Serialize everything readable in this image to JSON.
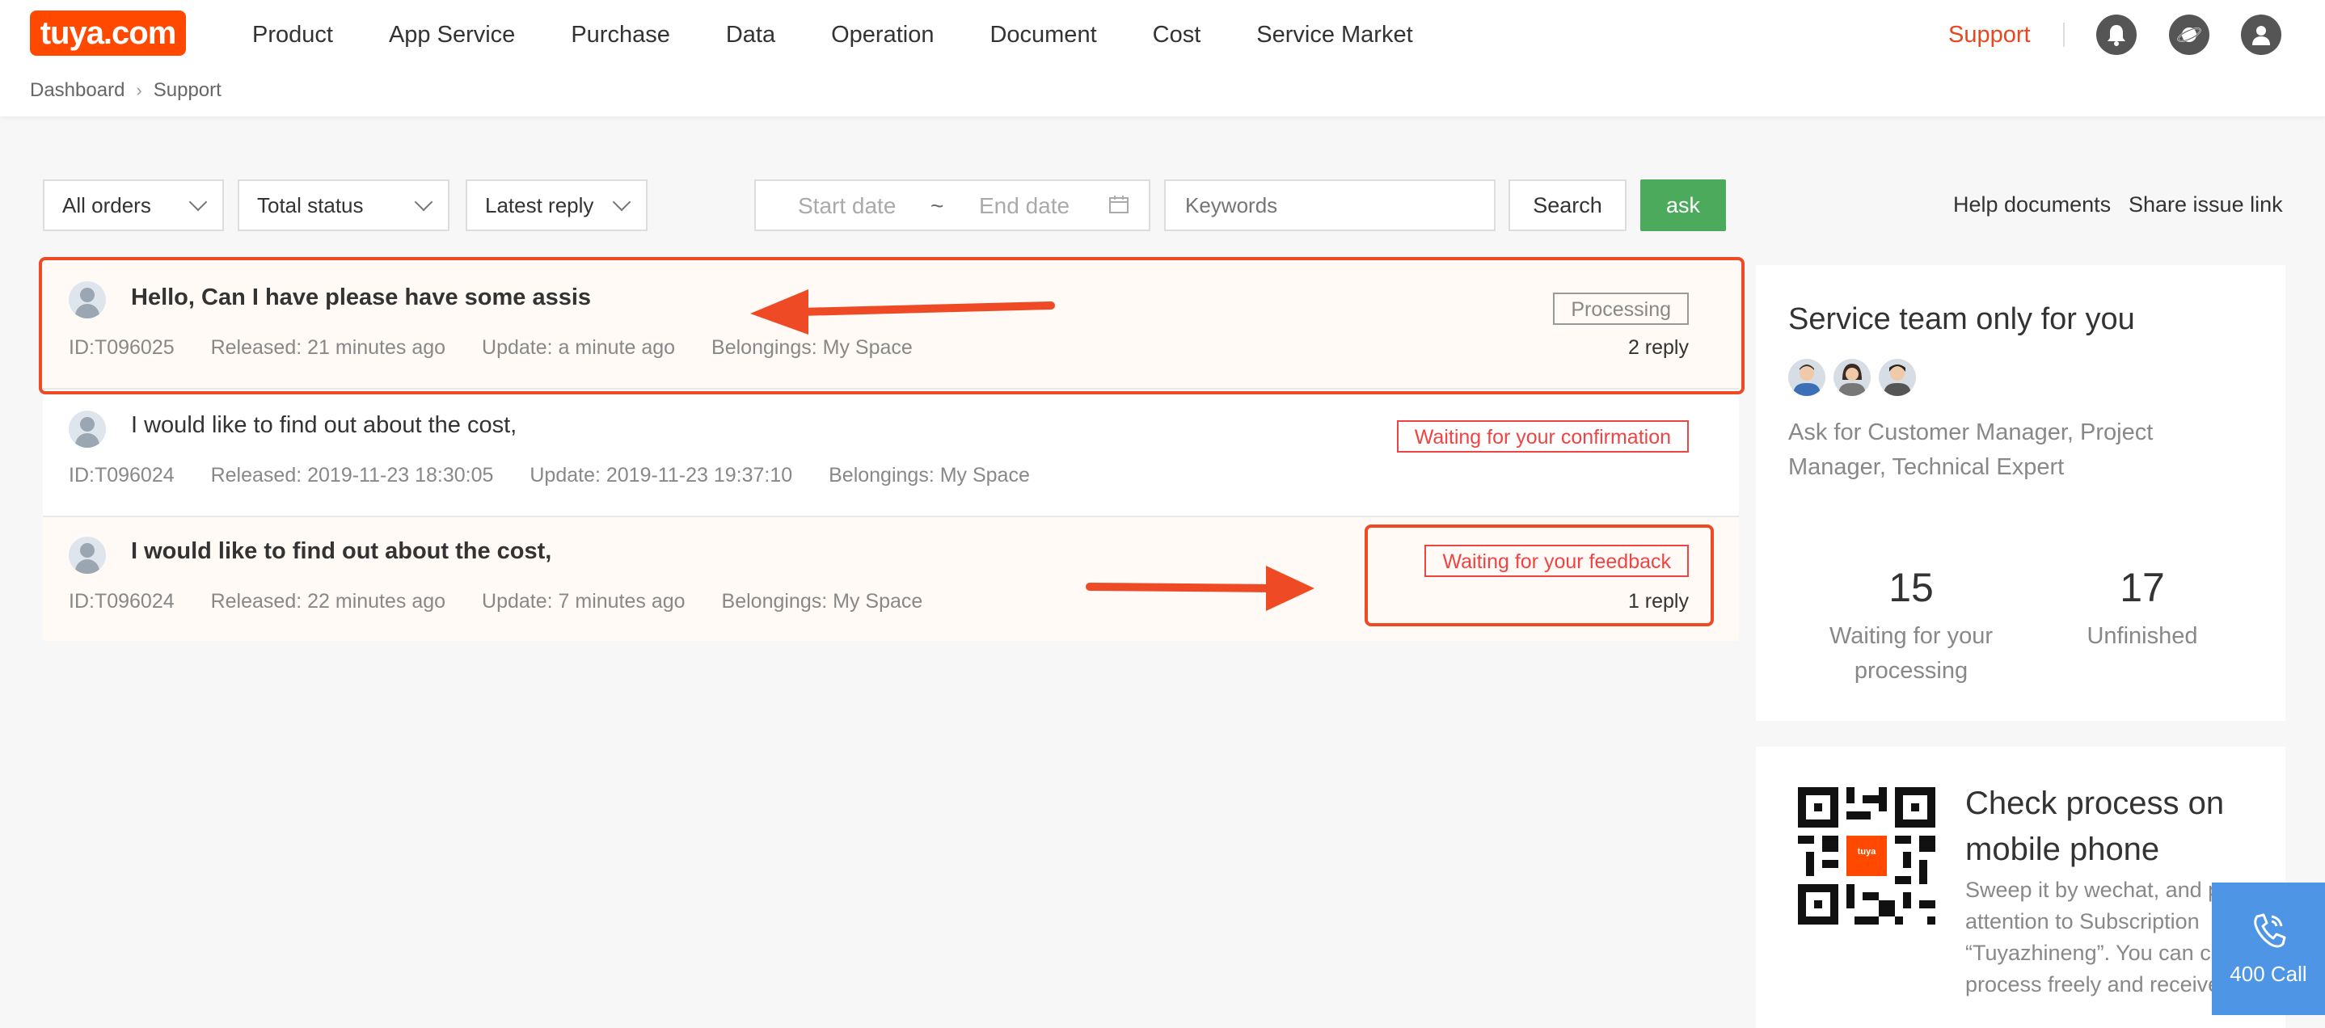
{
  "header": {
    "logo_text": "tuya.com",
    "nav": [
      "Product",
      "App Service",
      "Purchase",
      "Data",
      "Operation",
      "Document",
      "Cost",
      "Service Market"
    ],
    "support": "Support",
    "icons": [
      "bell-icon",
      "planet-icon",
      "user-icon"
    ]
  },
  "breadcrumb": [
    "Dashboard",
    "Support"
  ],
  "filters": {
    "orders": "All orders",
    "status": "Total status",
    "sort": "Latest reply",
    "start_date_placeholder": "Start date",
    "date_sep": "~",
    "end_date_placeholder": "End date",
    "keywords_placeholder": "Keywords",
    "search": "Search",
    "ask": "ask",
    "help_documents": "Help documents",
    "share_issue_link": "Share issue link"
  },
  "tickets": [
    {
      "title": "Hello, Can I have please have some assis",
      "id": "ID:T096025",
      "released": "Released: 21 minutes ago",
      "update": "Update: a minute ago",
      "belongings": "Belongings: My Space",
      "status": "Processing",
      "replies": "2 reply"
    },
    {
      "title": "I would like to find out about the cost,",
      "id": "ID:T096024",
      "released": "Released: 2019-11-23 18:30:05",
      "update": "Update: 2019-11-23 19:37:10",
      "belongings": "Belongings: My Space",
      "status": "Waiting for your confirmation",
      "replies": ""
    },
    {
      "title": "I would like to find out about the cost,",
      "id": "ID:T096024",
      "released": "Released: 22 minutes ago",
      "update": "Update: 7 minutes ago",
      "belongings": "Belongings: My Space",
      "status": "Waiting for your feedback",
      "replies": "1 reply"
    }
  ],
  "service_team": {
    "title": "Service team only for you",
    "description": "Ask for Customer Manager, Project Manager, Technical Expert",
    "stats": [
      {
        "value": "15",
        "label": "Waiting for your processing"
      },
      {
        "value": "17",
        "label": "Unfinished"
      }
    ]
  },
  "mobile": {
    "title": "Check process on mobile phone",
    "description": "Sweep it by wechat, and pay attention to Subscription “Tuyazhineng”. You can check process freely and receive",
    "qr_logo": "tuya"
  },
  "call": {
    "label": "400 Call"
  },
  "colors": {
    "brand": "#ff4800",
    "accent": "#ee4a25",
    "ask": "#4caa5c",
    "call": "#4e95e6"
  }
}
